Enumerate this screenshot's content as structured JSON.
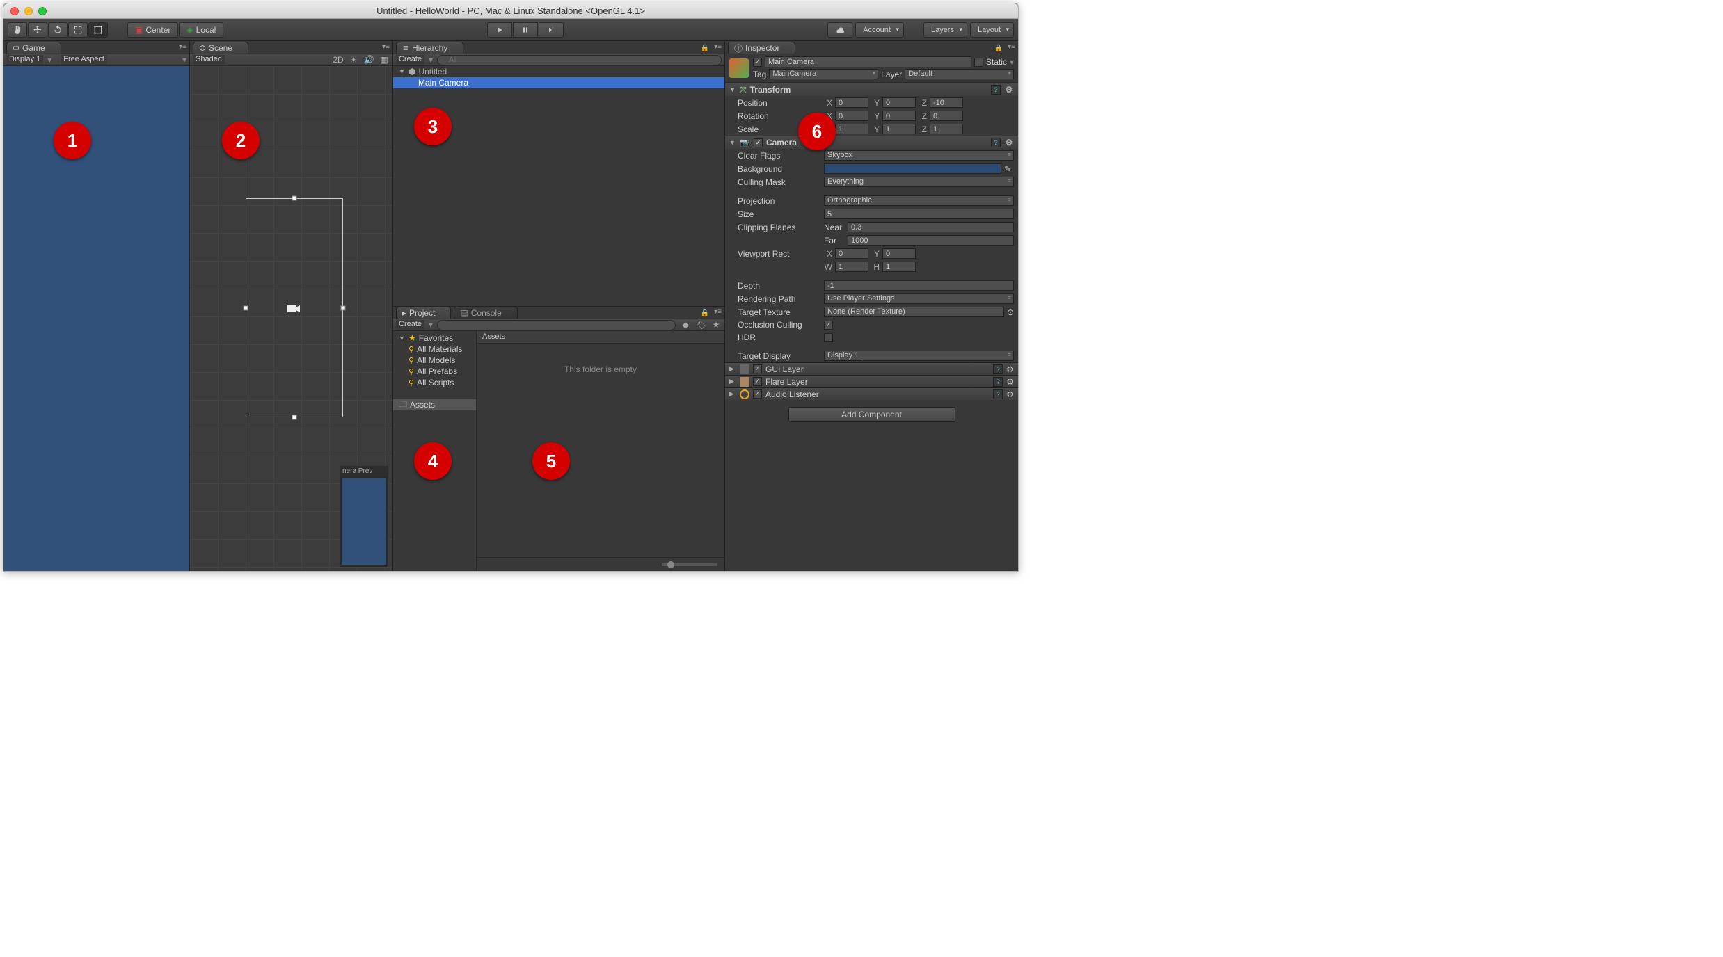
{
  "window": {
    "title": "Untitled - HelloWorld - PC, Mac & Linux Standalone <OpenGL 4.1>"
  },
  "toolbar": {
    "center": "Center",
    "local": "Local",
    "account": "Account",
    "layers": "Layers",
    "layout": "Layout"
  },
  "game": {
    "tab": "Game",
    "display": "Display 1",
    "aspect": "Free Aspect"
  },
  "scene": {
    "tab": "Scene",
    "shading": "Shaded",
    "button2d": "2D",
    "preview_label": "nera Prev"
  },
  "hierarchy": {
    "tab": "Hierarchy",
    "create": "Create",
    "search_placeholder": "All",
    "scene_name": "Untitled",
    "items": [
      "Main Camera"
    ]
  },
  "project": {
    "tab": "Project",
    "console_tab": "Console",
    "create": "Create",
    "favorites": "Favorites",
    "fav_items": [
      "All Materials",
      "All Models",
      "All Prefabs",
      "All Scripts"
    ],
    "assets": "Assets",
    "content_header": "Assets",
    "empty": "This folder is empty"
  },
  "inspector": {
    "tab": "Inspector",
    "name": "Main Camera",
    "static": "Static",
    "tag_label": "Tag",
    "tag": "MainCamera",
    "layer_label": "Layer",
    "layer": "Default",
    "transform": {
      "title": "Transform",
      "position": {
        "label": "Position",
        "x": "0",
        "y": "0",
        "z": "-10"
      },
      "rotation": {
        "label": "Rotation",
        "x": "0",
        "y": "0",
        "z": "0"
      },
      "scale": {
        "label": "Scale",
        "x": "1",
        "y": "1",
        "z": "1"
      }
    },
    "camera": {
      "title": "Camera",
      "clear_flags": {
        "label": "Clear Flags",
        "value": "Skybox"
      },
      "background": {
        "label": "Background"
      },
      "culling": {
        "label": "Culling Mask",
        "value": "Everything"
      },
      "projection": {
        "label": "Projection",
        "value": "Orthographic"
      },
      "size": {
        "label": "Size",
        "value": "5"
      },
      "clipping": {
        "label": "Clipping Planes",
        "near_label": "Near",
        "near": "0.3",
        "far_label": "Far",
        "far": "1000"
      },
      "viewport": {
        "label": "Viewport Rect",
        "x": "0",
        "y": "0",
        "w": "1",
        "h": "1"
      },
      "depth": {
        "label": "Depth",
        "value": "-1"
      },
      "rendering": {
        "label": "Rendering Path",
        "value": "Use Player Settings"
      },
      "texture": {
        "label": "Target Texture",
        "value": "None (Render Texture)"
      },
      "occlusion": {
        "label": "Occlusion Culling",
        "checked": true
      },
      "hdr": {
        "label": "HDR",
        "checked": false
      },
      "target_display": {
        "label": "Target Display",
        "value": "Display 1"
      }
    },
    "components": {
      "gui": "GUI Layer",
      "flare": "Flare Layer",
      "audio": "Audio Listener"
    },
    "add_component": "Add Component"
  },
  "badges": [
    "1",
    "2",
    "3",
    "4",
    "5",
    "6"
  ]
}
